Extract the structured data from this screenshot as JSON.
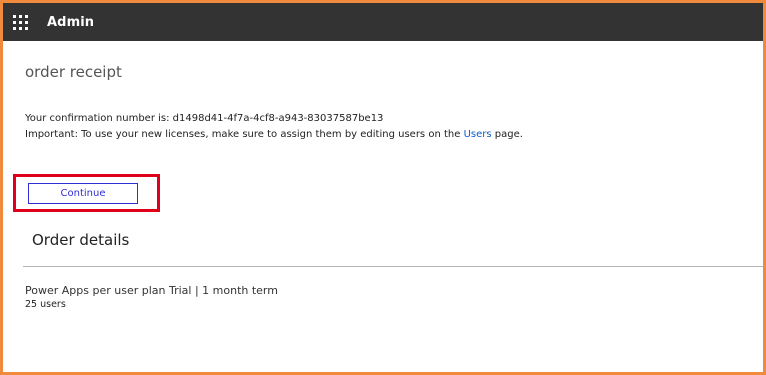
{
  "header": {
    "app_title": "Admin",
    "icon": "waffle-icon"
  },
  "page": {
    "title": "order receipt",
    "confirmation_text": "Your confirmation number is: d1498d41-4f7a-4cf8-a943-83037587be13",
    "important_prefix": "Important: To use your new licenses, make sure to assign them by editing users on the ",
    "users_link": "Users",
    "important_suffix": " page."
  },
  "actions": {
    "continue_label": "Continue"
  },
  "order_details": {
    "title": "Order details",
    "items": [
      {
        "name": "Power Apps per user plan Trial | 1 month term",
        "quantity": "25 users"
      }
    ]
  },
  "colors": {
    "topbar": "#333333",
    "frame_border": "#f08a3c",
    "highlight": "#e0001b",
    "link": "#0b5cc4",
    "button": "#2f2fd6"
  }
}
